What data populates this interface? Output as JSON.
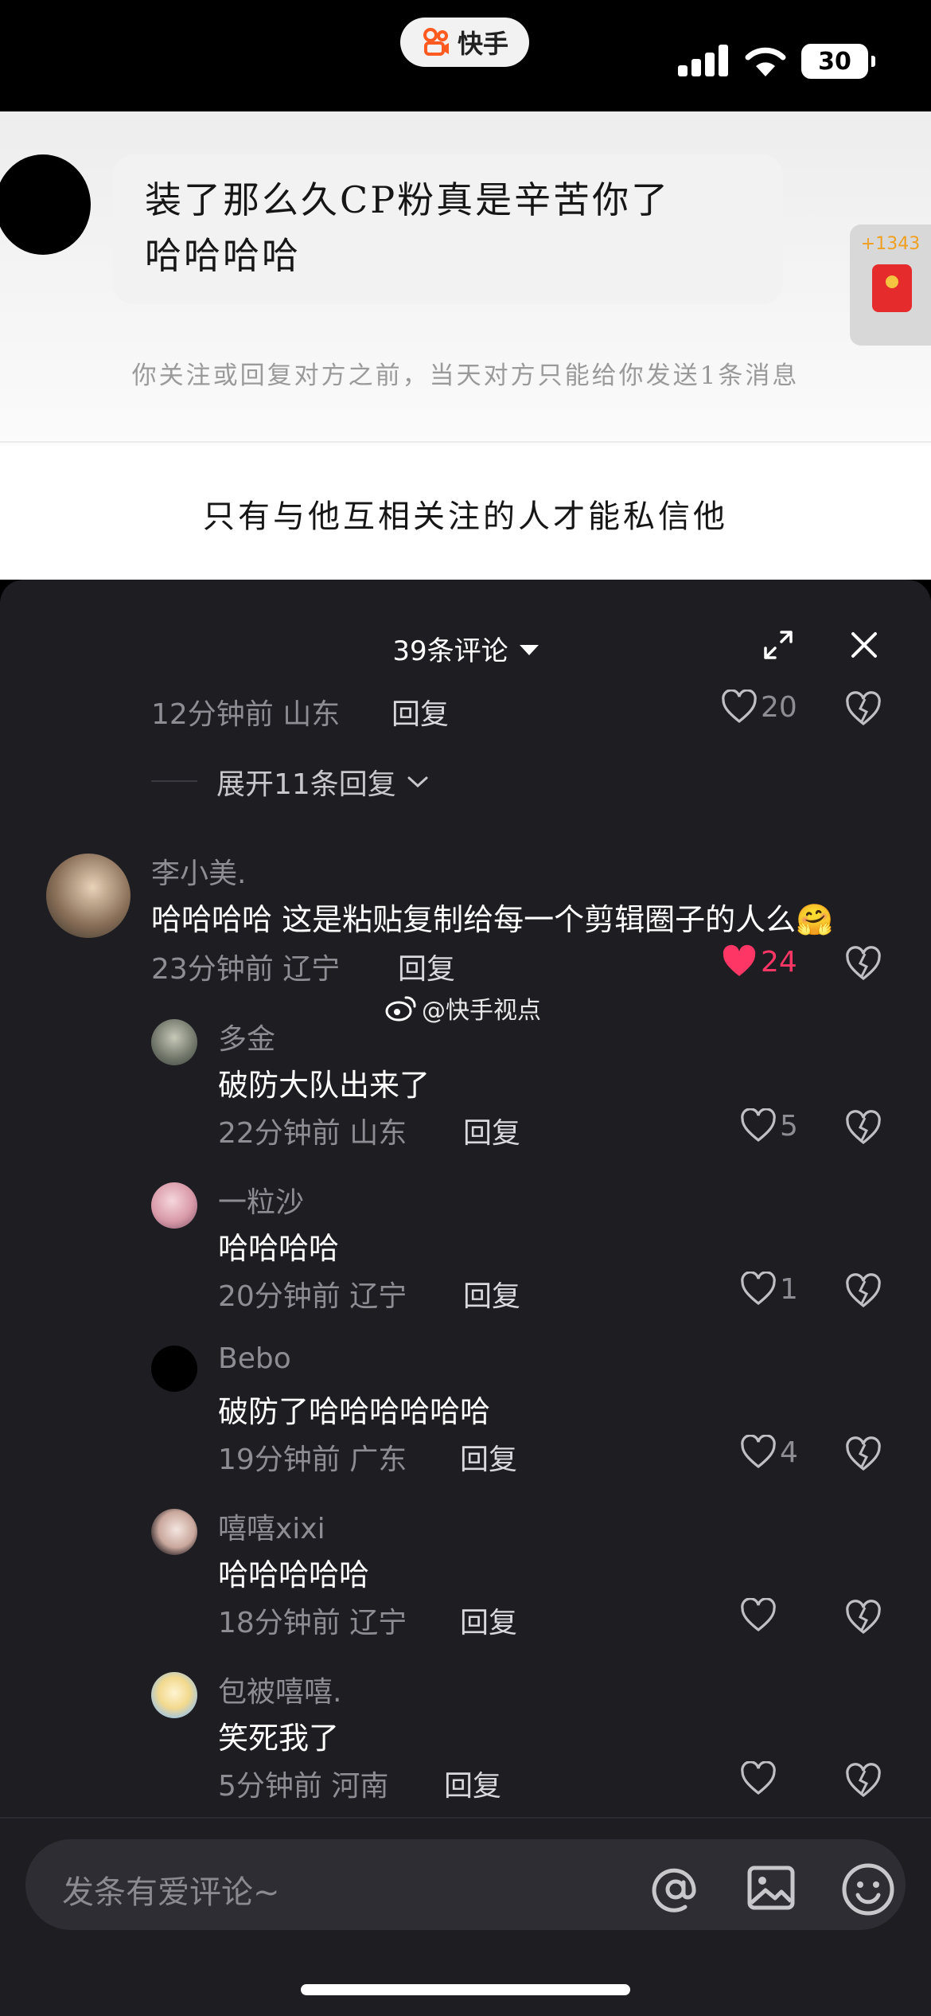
{
  "status_bar": {
    "app_name": "快手",
    "battery": "30"
  },
  "chat": {
    "message": "装了那么久CP粉真是辛苦你了",
    "message_line2": "哈哈哈哈",
    "red_packet_count": "+1343",
    "notice": "你关注或回复对方之前，当天对方只能给你发送1条消息",
    "restriction": "只有与他互相关注的人才能私信他"
  },
  "comments_panel": {
    "title": "39条评论",
    "reply_label": "回复",
    "top_partial": {
      "meta": "12分钟前 山东",
      "likes": "20"
    },
    "expand_label": "展开11条回复",
    "main_comment": {
      "user": "李小美.",
      "text": "哈哈哈哈 这是粘贴复制给每一个剪辑圈子的人么🤗",
      "meta": "23分钟前 辽宁",
      "likes": "24"
    },
    "replies": [
      {
        "user": "多金",
        "text": "破防大队出来了",
        "meta": "22分钟前 山东",
        "likes": "5"
      },
      {
        "user": "一粒沙",
        "text": "哈哈哈哈",
        "meta": "20分钟前 辽宁",
        "likes": "1"
      },
      {
        "user": "Bebo",
        "text": "破防了哈哈哈哈哈哈",
        "meta": "19分钟前 广东",
        "likes": "4"
      },
      {
        "user": "嘻嘻xixi",
        "text": "哈哈哈哈哈",
        "meta": "18分钟前 辽宁",
        "likes": ""
      },
      {
        "user": "包被嘻嘻.",
        "text": "笑死我了",
        "meta": "5分钟前 河南",
        "likes": ""
      }
    ],
    "watermark": "@快手视点"
  },
  "input": {
    "placeholder": "发条有爱评论~"
  },
  "colors": {
    "sheet_bg": "#1d1d22",
    "liked": "#fe3666",
    "brand": "#ff5a1f"
  }
}
